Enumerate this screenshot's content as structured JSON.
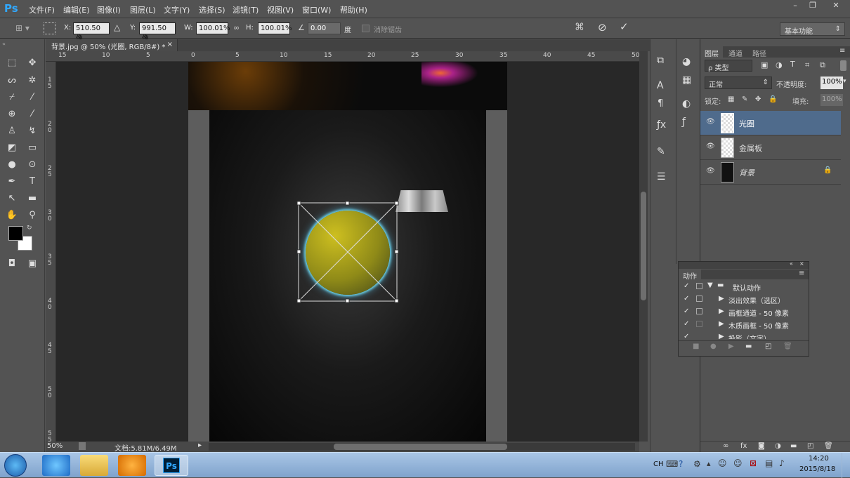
{
  "app": {
    "logo": "Ps",
    "menus": [
      "文件(F)",
      "编辑(E)",
      "图像(I)",
      "图层(L)",
      "文字(Y)",
      "选择(S)",
      "滤镜(T)",
      "视图(V)",
      "窗口(W)",
      "帮助(H)"
    ],
    "window_buttons": [
      "–",
      "❐",
      "✕"
    ]
  },
  "options": {
    "x_label": "X:",
    "x_value": "510.50 像",
    "y_label": "Y:",
    "y_value": "991.50 像",
    "w_label": "W:",
    "w_value": "100.01%",
    "h_label": "H:",
    "h_value": "100.01%",
    "angle_value": "0.00",
    "angle_unit": "度",
    "antialias_label": "消除锯齿",
    "workspace": "基本功能"
  },
  "document": {
    "tab_title": "背景.jpg @ 50% (光圈, RGB/8#) *",
    "zoom": "50%",
    "doc_info": "文档:5.81M/6.49M"
  },
  "ruler": {
    "top_ticks": [
      "15",
      "10",
      "5",
      "0",
      "5",
      "10",
      "15",
      "20",
      "25",
      "30",
      "35",
      "40",
      "45",
      "50"
    ],
    "left_ticks": [
      "1\n5",
      "2\n0",
      "2\n5",
      "3\n0",
      "3\n5",
      "4\n0",
      "4\n5",
      "5\n0",
      "5\n5"
    ]
  },
  "layers_panel": {
    "tabs": [
      "图层",
      "通道",
      "路径"
    ],
    "filter_label": "ρ 类型",
    "blend_mode": "正常",
    "opacity_label": "不透明度:",
    "opacity_value": "100%",
    "lock_label": "锁定:",
    "fill_label": "填充:",
    "fill_value": "100%",
    "layers": [
      {
        "name": "光圈",
        "selected": true
      },
      {
        "name": "金属板",
        "selected": false
      },
      {
        "name": "背景",
        "selected": false
      }
    ]
  },
  "actions_panel": {
    "title": "动作",
    "items": [
      {
        "label": "默认动作",
        "type": "folder"
      },
      {
        "label": "淡出效果（选区）",
        "type": "action"
      },
      {
        "label": "画框通道 - 50 像素",
        "type": "action"
      },
      {
        "label": "木质画框 - 50 像素",
        "type": "action"
      },
      {
        "label": "投影（文字）",
        "type": "action"
      }
    ]
  },
  "taskbar": {
    "lang": "CH",
    "time": "14:20",
    "date": "2015/8/18"
  },
  "colors": {
    "selected_layer": "#4f6b8c",
    "ps_blue": "#31a8ff"
  }
}
